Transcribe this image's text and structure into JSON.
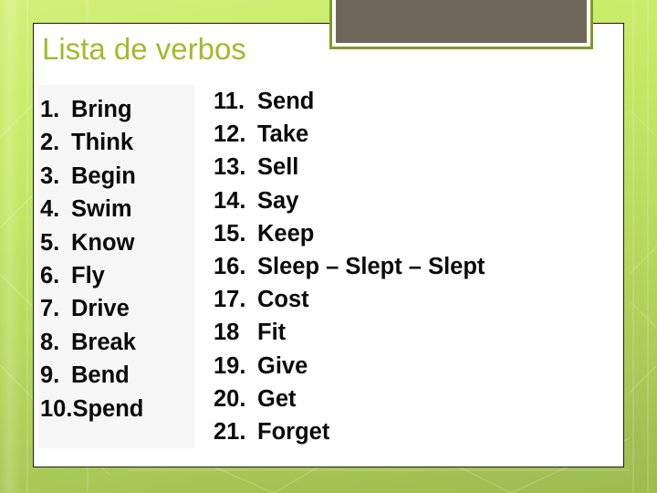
{
  "slide": {
    "title": "Lista de verbos",
    "title_color": "#9fbc2c",
    "background_top_color": "#d3f07a",
    "background_bottom_color": "#9dbb50",
    "panel_background_color": "#ffffff",
    "list_text_color": "#0a0a0a"
  },
  "picture_box": {
    "fill_color": "#70675a",
    "border_color": "#7d9b27",
    "inner_border_color": "#ffffff"
  },
  "left_column": {
    "panel_color": "#f6f6f6",
    "items": [
      {
        "num": "1.",
        "word": "Bring"
      },
      {
        "num": "2.",
        "word": "Think"
      },
      {
        "num": "3.",
        "word": "Begin"
      },
      {
        "num": "4.",
        "word": "Swim"
      },
      {
        "num": "5.",
        "word": "Know"
      },
      {
        "num": "6.",
        "word": "Fly"
      },
      {
        "num": "7.",
        "word": "Drive"
      },
      {
        "num": "8.",
        "word": "Break"
      },
      {
        "num": "9.",
        "word": "Bend"
      },
      {
        "num": "10.",
        "word": "Spend"
      }
    ]
  },
  "right_column": {
    "items": [
      {
        "num": "11.",
        "word": "Send"
      },
      {
        "num": "12.",
        "word": "Take"
      },
      {
        "num": "13.",
        "word": "Sell"
      },
      {
        "num": "14.",
        "word": "Say"
      },
      {
        "num": "15.",
        "word": "Keep"
      },
      {
        "num": "16.",
        "word": "Sleep – Slept – Slept"
      },
      {
        "num": "17.",
        "word": "Cost"
      },
      {
        "num": "18",
        "word": "Fit"
      },
      {
        "num": "19.",
        "word": "Give"
      },
      {
        "num": "20.",
        "word": "Get"
      },
      {
        "num": "21.",
        "word": "Forget"
      }
    ]
  }
}
